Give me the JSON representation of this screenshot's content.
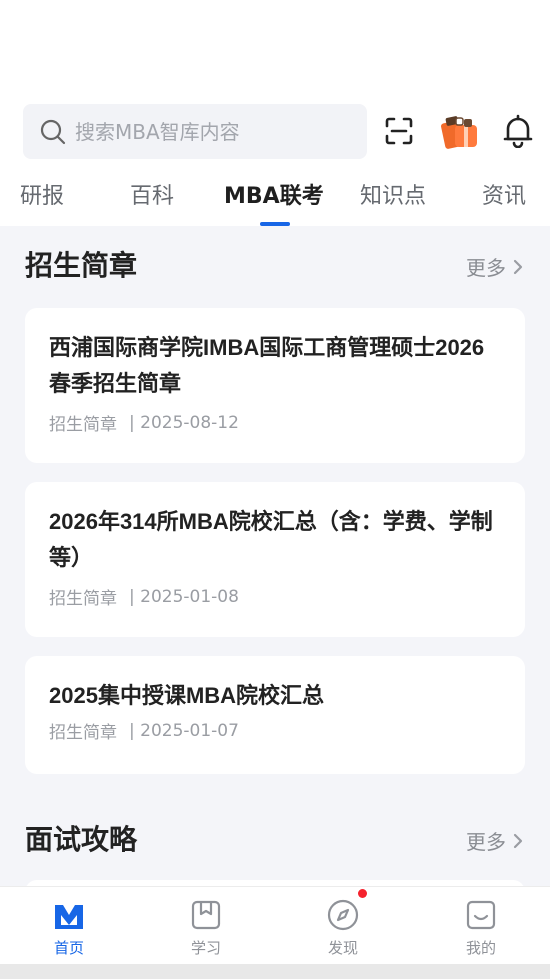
{
  "search": {
    "placeholder": "搜索MBA智库内容",
    "icon": "search-icon"
  },
  "header_icons": {
    "scan": "scan-icon",
    "gift": "gift-icon",
    "bell": "bell-icon"
  },
  "tabs": [
    {
      "label": "研报"
    },
    {
      "label": "百科"
    },
    {
      "label": "MBA联考"
    },
    {
      "label": "知识点"
    },
    {
      "label": "资讯"
    }
  ],
  "active_tab": "MBA联考",
  "sections": {
    "admissions": {
      "title": "招生简章",
      "more": "更多",
      "articles": [
        {
          "title": "西浦国际商学院IMBA国际工商管理硕士2026春季招生简章",
          "category": "招生简章",
          "date": "| 2025-08-12"
        },
        {
          "title": "2026年314所MBA院校汇总（含：学费、学制等）",
          "category": "招生简章",
          "date": "| 2025-01-08"
        },
        {
          "title": "2025集中授课MBA院校汇总",
          "category": "招生简章",
          "date": "| 2025-01-07"
        }
      ]
    },
    "interview": {
      "title": "面试攻略",
      "more": "更多"
    }
  },
  "bottom_nav": [
    {
      "label": "首页",
      "icon": "home-logo-icon",
      "active": true
    },
    {
      "label": "学习",
      "icon": "bookmark-book-icon",
      "active": false
    },
    {
      "label": "发现",
      "icon": "compass-icon",
      "active": false,
      "badge": true
    },
    {
      "label": "我的",
      "icon": "profile-face-icon",
      "active": false
    }
  ],
  "colors": {
    "accent": "#1766e6",
    "badge": "#f5222d",
    "background": "#f4f5f9"
  }
}
